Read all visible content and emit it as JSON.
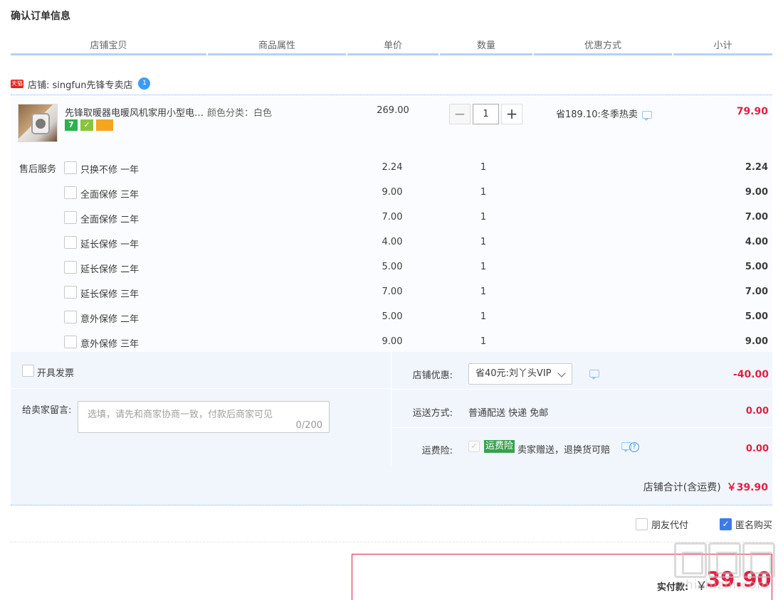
{
  "page": {
    "title": "确认订单信息"
  },
  "columns": [
    "店铺宝贝",
    "商品属性",
    "单价",
    "数量",
    "优惠方式",
    "小计"
  ],
  "shop": {
    "badge": "天猫",
    "label": "店铺: singfun先锋专卖店",
    "ww_badge": "1"
  },
  "product": {
    "title": "先锋取暖器电暖风机家用小型电暖器",
    "badges": [
      "7",
      "✓",
      ""
    ],
    "attribute": "颜色分类：白色",
    "unit_price": "269.00",
    "quantity": "1",
    "qty_minus": "−",
    "qty_plus": "+",
    "promo": "省189.10:冬季热卖",
    "subtotal": "79.90"
  },
  "service": {
    "label": "售后服务",
    "items": [
      {
        "name": "只换不修 一年",
        "price": "2.24",
        "quantity": "1",
        "subtotal": "2.24"
      },
      {
        "name": "全面保修 三年",
        "price": "9.00",
        "quantity": "1",
        "subtotal": "9.00"
      },
      {
        "name": "全面保修 二年",
        "price": "7.00",
        "quantity": "1",
        "subtotal": "7.00"
      },
      {
        "name": "延长保修 一年",
        "price": "4.00",
        "quantity": "1",
        "subtotal": "4.00"
      },
      {
        "name": "延长保修 二年",
        "price": "5.00",
        "quantity": "1",
        "subtotal": "5.00"
      },
      {
        "name": "延长保修 三年",
        "price": "7.00",
        "quantity": "1",
        "subtotal": "7.00"
      },
      {
        "name": "意外保修 二年",
        "price": "5.00",
        "quantity": "1",
        "subtotal": "5.00"
      },
      {
        "name": "意外保修 三年",
        "price": "9.00",
        "quantity": "1",
        "subtotal": "9.00"
      }
    ]
  },
  "invoice": {
    "label": "开具发票"
  },
  "message": {
    "label": "给卖家留言:",
    "placeholder": "选填，请先和商家协商一致，付款后商家可见",
    "count": "0/200"
  },
  "shop_discount": {
    "label": "店铺优惠:",
    "selected": "省40元:刘丫头VIP",
    "amount": "-40.00"
  },
  "shipping": {
    "label": "运送方式:",
    "value": "普通配送 快递 免邮",
    "amount": "0.00"
  },
  "insurance": {
    "label": "运费险:",
    "tag": "运费险",
    "text": "卖家赠送，退换货可赔",
    "help": "?",
    "amount": "0.00"
  },
  "shop_total": {
    "label": "店铺合计(含运费)",
    "amount": "￥39.90"
  },
  "options": {
    "friend_pay": "朋友代付",
    "anonymous": "匿名购买",
    "anonymous_checked": true,
    "check_mark": "✓"
  },
  "payment": {
    "label": "实付款:",
    "currency": "￥",
    "amount": "39.90"
  },
  "watermark": {
    "text": "zhizhizhi.com"
  },
  "colors": {
    "accent_red": "#e21f42",
    "header_underline": "#b2d1ff",
    "checkbox_blue": "#3b7be9",
    "insurance_green": "#36a24e"
  }
}
